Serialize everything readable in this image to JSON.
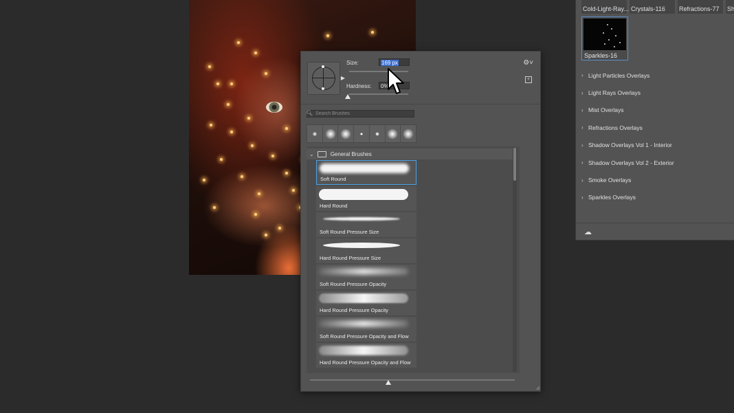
{
  "brush_popup": {
    "size_label": "Size:",
    "size_value": "169 px",
    "hardness_label": "Hardness:",
    "hardness_value": "0%",
    "search_placeholder": "Search Brushes",
    "group_name": "General Brushes",
    "brushes": [
      {
        "label": "Soft Round",
        "selected": true
      },
      {
        "label": "Hard Round",
        "selected": false
      },
      {
        "label": "Soft Round Pressure Size",
        "selected": false
      },
      {
        "label": "Hard Round Pressure Size",
        "selected": false
      },
      {
        "label": "Soft Round Pressure Opacity",
        "selected": false
      },
      {
        "label": "Hard Round Pressure Opacity",
        "selected": false
      },
      {
        "label": "Soft Round Pressure Opacity and Flow",
        "selected": false
      },
      {
        "label": "Hard Round Pressure Opacity and Flow",
        "selected": false
      }
    ]
  },
  "libraries": {
    "top_thumbs": [
      "Cold-Light-Ray...",
      "Crystals-116",
      "Refractions-77",
      "Sha"
    ],
    "selected_thumb": "Sparkles-16",
    "categories": [
      "Light Particles Overlays",
      "Light Rays Overlays",
      "Mist Overlays",
      "Refractions Overlays",
      "Shadow Overlays Vol 1 - Interior",
      "Shadow Overlays Vol 2 - Exterior",
      "Smoke Overlays",
      "Sparkles Overlays"
    ]
  },
  "colors": {
    "panel": "#535353",
    "canvas_bg": "#2b2b2b",
    "selection_accent": "#4aa3ea",
    "text_selection": "#3b6fd4"
  }
}
